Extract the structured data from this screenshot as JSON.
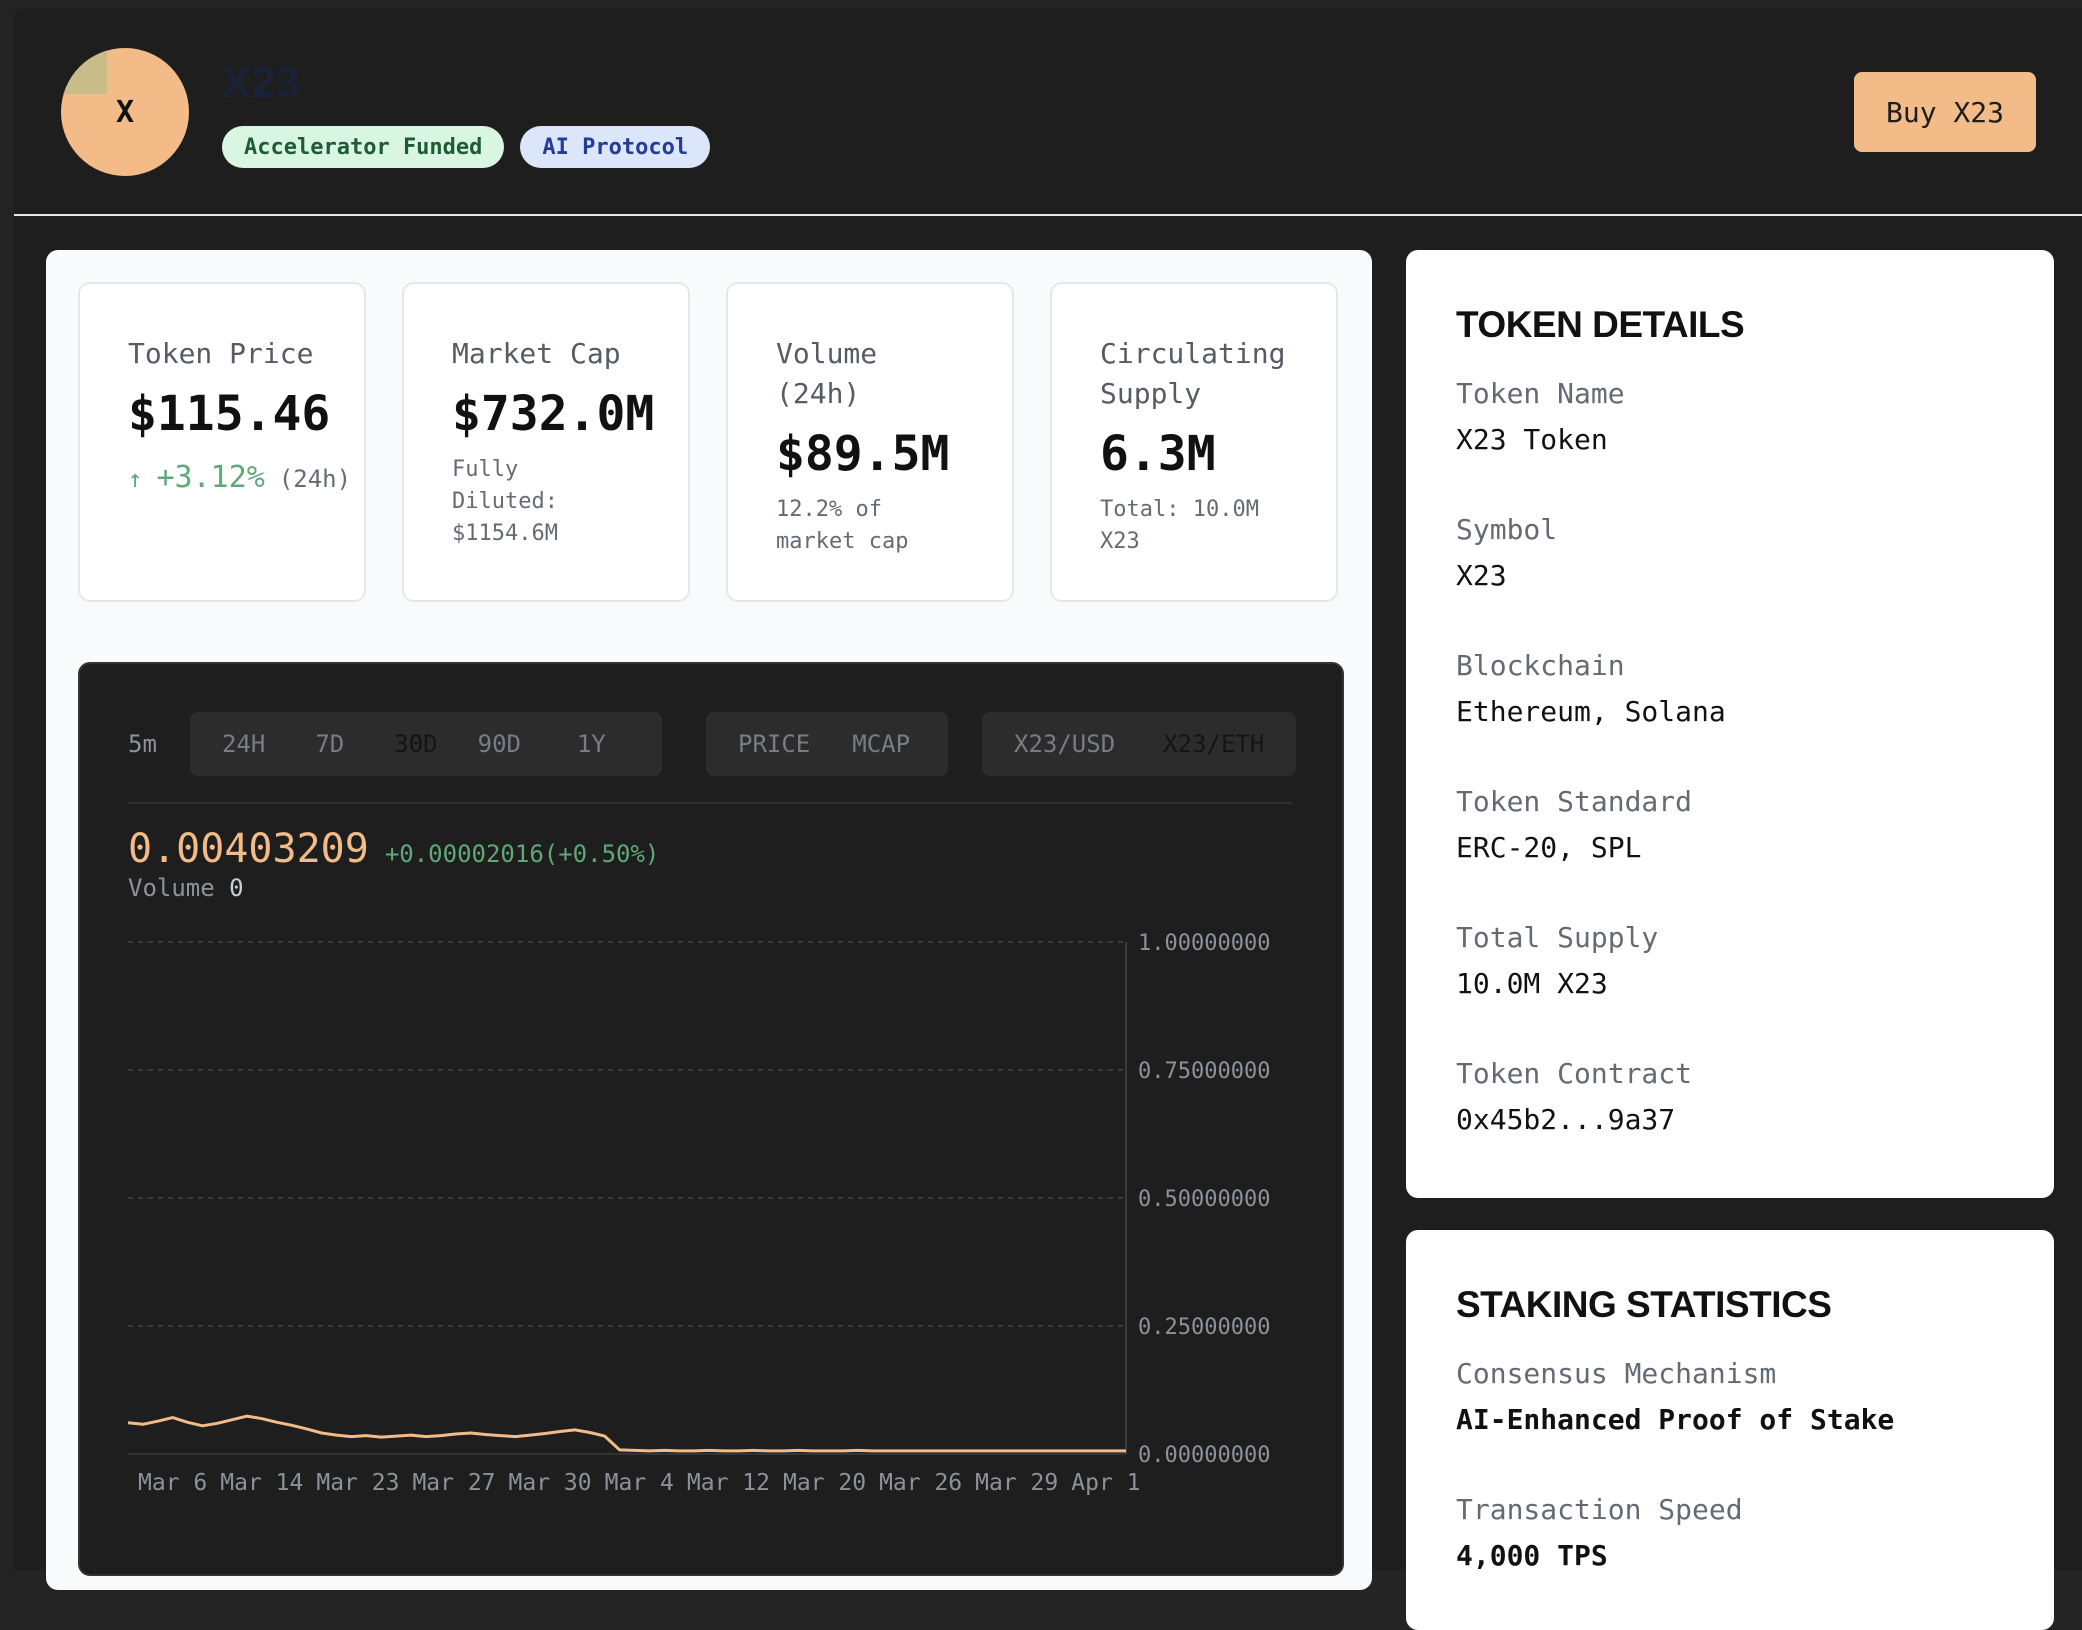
{
  "header": {
    "avatar_letter": "X",
    "token_title": "X23",
    "badges": [
      "Accelerator Funded",
      "AI Protocol"
    ],
    "buy_label": "Buy X23"
  },
  "stats": {
    "price": {
      "label": "Token Price",
      "value": "$115.46",
      "change": "+3.12%",
      "period": "(24h)"
    },
    "market_cap": {
      "label": "Market Cap",
      "value": "$732.0M",
      "sub_line1": "Fully",
      "sub_line2": "Diluted:",
      "sub_line3": "$1154.6M"
    },
    "volume": {
      "label_line1": "Volume",
      "label_line2": "(24h)",
      "value": "$89.5M",
      "sub_line1": "12.2% of",
      "sub_line2": "market cap"
    },
    "supply": {
      "label_line1": "Circulating",
      "label_line2": "Supply",
      "value": "6.3M",
      "sub_line1": "Total: 10.0M",
      "sub_line2": "X23"
    }
  },
  "chart_toolbar": {
    "interval": "5m",
    "ranges": [
      "24H",
      "7D",
      "30D",
      "90D",
      "1Y"
    ],
    "active_range": "30D",
    "metrics": [
      "PRICE",
      "MCAP"
    ],
    "active_metric": "PRICE",
    "pairs": [
      "X23/USD",
      "X23/ETH"
    ],
    "active_pair": "X23/ETH"
  },
  "chart_header": {
    "current_price": "0.00403209",
    "change": "+0.00002016(+0.50%)",
    "volume_label": "Volume",
    "volume_value": "0"
  },
  "chart_data": {
    "type": "line",
    "x_ticks": [
      "Mar 6",
      "Mar 14",
      "Mar 23",
      "Mar 27",
      "Mar 30",
      "Mar 4",
      "Mar 12",
      "Mar 20",
      "Mar 26",
      "Mar 29",
      "Apr 1"
    ],
    "y_ticks": [
      "1.00000000",
      "0.75000000",
      "0.50000000",
      "0.25000000",
      "0.00000000"
    ],
    "ylim": [
      0,
      1
    ],
    "grid": true,
    "series": [
      {
        "color": "#f2bb88",
        "values": [
          0.061,
          0.058,
          0.064,
          0.071,
          0.062,
          0.055,
          0.06,
          0.067,
          0.074,
          0.069,
          0.062,
          0.056,
          0.049,
          0.041,
          0.037,
          0.034,
          0.036,
          0.033,
          0.035,
          0.037,
          0.034,
          0.036,
          0.039,
          0.041,
          0.038,
          0.036,
          0.034,
          0.037,
          0.04,
          0.044,
          0.047,
          0.042,
          0.035,
          0.008,
          0.007,
          0.006,
          0.007,
          0.006,
          0.006,
          0.007,
          0.006,
          0.006,
          0.007,
          0.006,
          0.006,
          0.007,
          0.006,
          0.006,
          0.006,
          0.007,
          0.006,
          0.006,
          0.006,
          0.006,
          0.006,
          0.006,
          0.006,
          0.006,
          0.006,
          0.006,
          0.006,
          0.006,
          0.006,
          0.006,
          0.006,
          0.006,
          0.006,
          0.006
        ]
      }
    ]
  },
  "details": {
    "title": "TOKEN DETAILS",
    "fields": [
      {
        "label": "Token Name",
        "value": "X23 Token"
      },
      {
        "label": "Symbol",
        "value": "X23"
      },
      {
        "label": "Blockchain",
        "value": "Ethereum, Solana"
      },
      {
        "label": "Token Standard",
        "value": "ERC-20, SPL"
      },
      {
        "label": "Total Supply",
        "value": "10.0M X23"
      },
      {
        "label": "Token Contract",
        "value": "0x45b2...9a37"
      }
    ]
  },
  "staking": {
    "title": "STAKING STATISTICS",
    "fields": [
      {
        "label": "Consensus Mechanism",
        "value": "AI-Enhanced Proof of Stake"
      },
      {
        "label": "Transaction Speed",
        "value": "4,000 TPS"
      }
    ]
  }
}
